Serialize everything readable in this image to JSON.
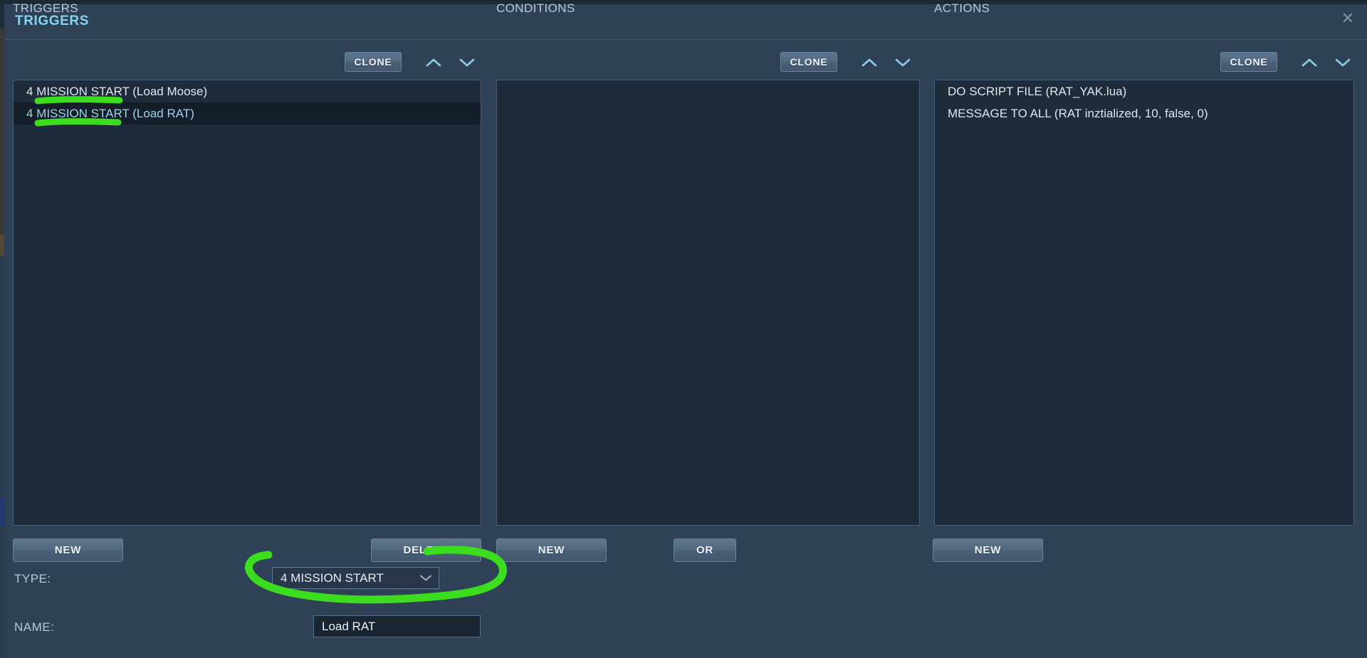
{
  "window": {
    "title": "TRIGGERS",
    "close_icon": "close-icon"
  },
  "columns": {
    "triggers": {
      "header": "TRIGGERS",
      "clone_label": "CLONE",
      "up_icon": "chevron-up-icon",
      "down_icon": "chevron-down-icon",
      "items": [
        {
          "label": "4 MISSION START (Load Moose)",
          "selected": false
        },
        {
          "label": "4 MISSION START (Load RAT)",
          "selected": true
        }
      ],
      "new_label": "NEW",
      "delete_label": "DELETE"
    },
    "conditions": {
      "header": "CONDITIONS",
      "clone_label": "CLONE",
      "up_icon": "chevron-up-icon",
      "down_icon": "chevron-down-icon",
      "items": [],
      "new_label": "NEW",
      "or_label": "OR"
    },
    "actions": {
      "header": "ACTIONS",
      "clone_label": "CLONE",
      "up_icon": "chevron-up-icon",
      "down_icon": "chevron-down-icon",
      "items": [
        {
          "label": "DO SCRIPT FILE (RAT_YAK.lua)",
          "selected": false
        },
        {
          "label": "MESSAGE TO ALL (RAT inztialized, 10, false, 0)",
          "selected": false
        }
      ],
      "new_label": "NEW"
    }
  },
  "form": {
    "type_label": "TYPE:",
    "type_value": "4 MISSION START",
    "type_chevron_icon": "chevron-down-icon",
    "name_label": "NAME:",
    "name_value": "Load RAT"
  },
  "colors": {
    "accent_title": "#82d4f0",
    "panel_bg": "#2e4156",
    "list_bg": "#1d2b3a",
    "selected_row_bg": "#151e29",
    "selected_row_text": "#9fd4ea",
    "button_face": "#52687f",
    "annotation_green": "#3cdd1e"
  },
  "annotations": {
    "underline_1": "green-underline-mission-start-moose",
    "underline_2": "green-underline-mission-start-rat",
    "circle": "green-circle-around-type-dropdown"
  }
}
